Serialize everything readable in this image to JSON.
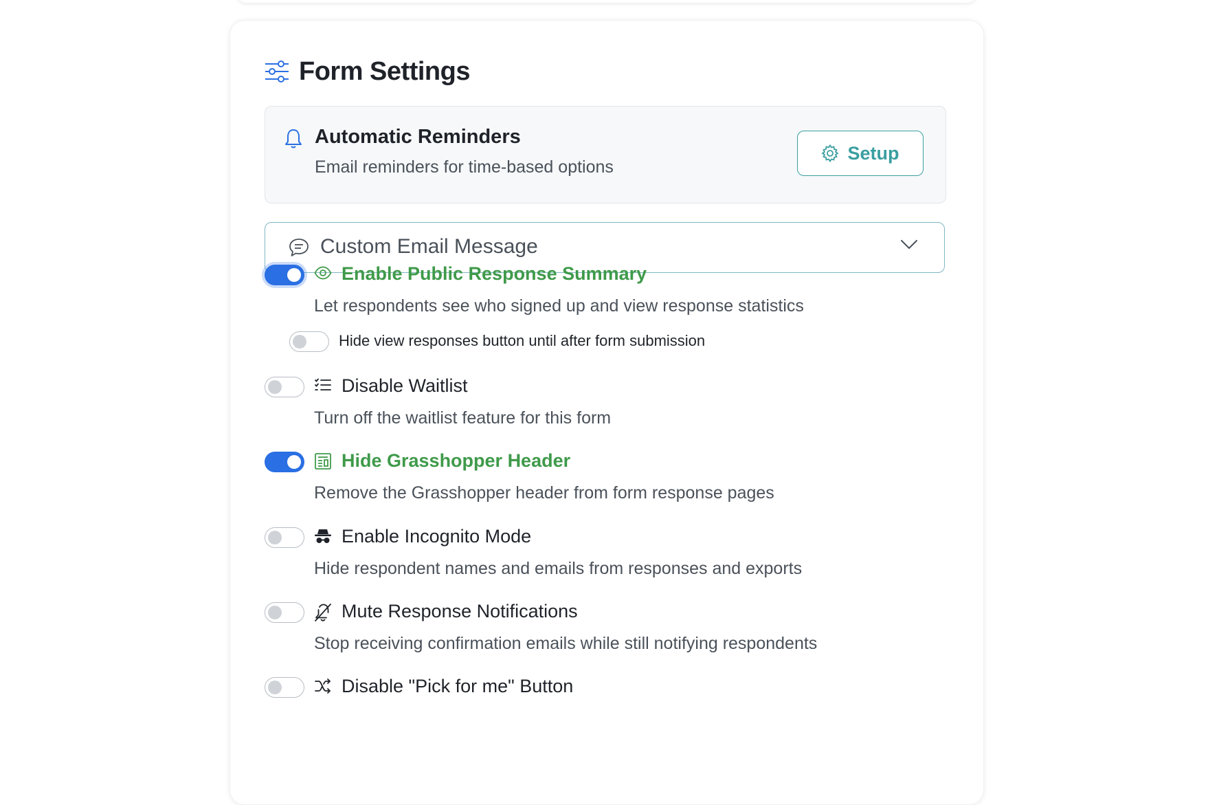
{
  "header": {
    "title": "Form Settings",
    "icon": "sliders-icon"
  },
  "reminders": {
    "title": "Automatic Reminders",
    "description": "Email reminders for time-based options",
    "setup_label": "Setup",
    "icon": "bell-icon"
  },
  "custom_email": {
    "label": "Custom Email Message",
    "icon": "chat-icon",
    "expanded": false
  },
  "settings": [
    {
      "label": "Enable Public Response Summary",
      "description": "Let respondents see who signed up and view response statistics",
      "enabled": true,
      "icon": "eye-icon"
    },
    {
      "label": "Disable Waitlist",
      "description": "Turn off the waitlist feature for this form",
      "enabled": false,
      "icon": "list-icon"
    },
    {
      "label": "Hide Grasshopper Header",
      "description": "Remove the Grasshopper header from form response pages",
      "enabled": true,
      "icon": "newspaper-icon"
    },
    {
      "label": "Enable Incognito Mode",
      "description": "Hide respondent names and emails from responses and exports",
      "enabled": false,
      "icon": "incognito-icon"
    },
    {
      "label": "Mute Response Notifications",
      "description": "Stop receiving confirmation emails while still notifying respondents",
      "enabled": false,
      "icon": "bell-off-icon"
    },
    {
      "label": "Disable \"Pick for me\" Button",
      "description": "",
      "enabled": false,
      "icon": "shuffle-icon"
    }
  ],
  "sub_settings": {
    "hide_view_responses": {
      "label": "Hide view responses button until after form submission",
      "enabled": false
    }
  },
  "colors": {
    "accent_blue": "#2a6fe3",
    "active_green": "#3f9a4a",
    "teal": "#3a9ea0"
  }
}
